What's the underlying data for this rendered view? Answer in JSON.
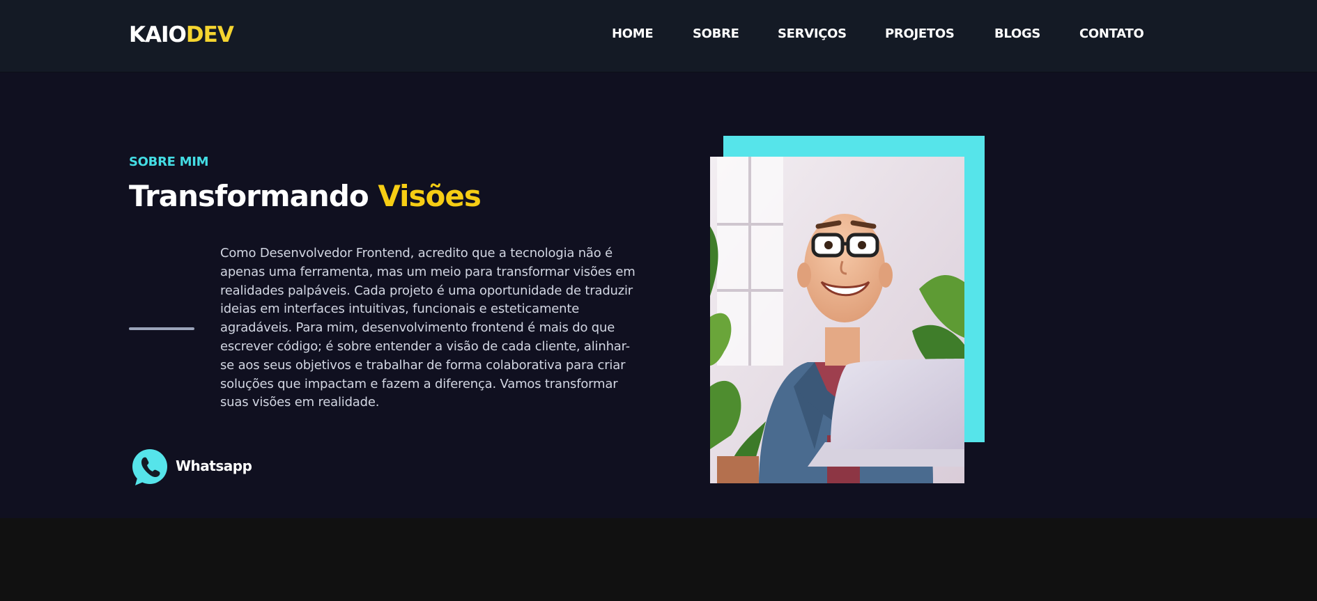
{
  "brand": {
    "logo_main": "KAIO",
    "logo_accent": "DEV"
  },
  "nav": {
    "items": [
      {
        "label": "HOME"
      },
      {
        "label": "SOBRE"
      },
      {
        "label": "SERVIÇOS"
      },
      {
        "label": "PROJETOS"
      },
      {
        "label": "BLOGS"
      },
      {
        "label": "CONTATO"
      }
    ]
  },
  "about": {
    "eyebrow": "SOBRE MIM",
    "title_main": "Transformando",
    "title_accent": "Visões",
    "paragraph": "Como Desenvolvedor Frontend, acredito que a tecnologia não é apenas uma ferramenta, mas um meio para transformar visões em realidades palpáveis. Cada projeto é uma oportunidade de traduzir ideias em interfaces intuitivas, funcionais e esteticamente agradáveis. Para mim, desenvolvimento frontend é mais do que escrever código; é sobre entender a visão de cada cliente, alinhar-se aos seus objetivos e trabalhar de forma colaborativa para criar soluções que impactam e fazem a diferença. Vamos transformar suas visões em realidade.",
    "cta_label": "Whatsapp",
    "photo_icon": "avatar-illustration"
  },
  "colors": {
    "nav_bg": "#141a25",
    "hero_bg": "#101020",
    "footer_bg": "#111111",
    "accent_yellow": "#f6cd14",
    "accent_cyan": "#44dde4",
    "frame_cyan": "#56e4ea",
    "text_light": "#d2d6e2"
  }
}
